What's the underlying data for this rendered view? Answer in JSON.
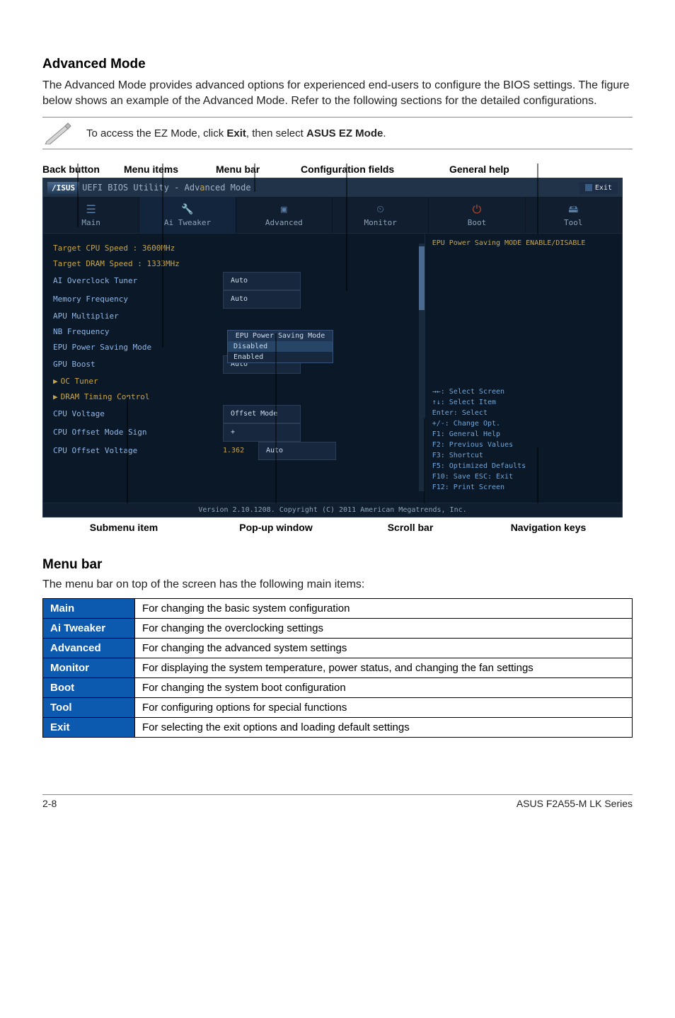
{
  "headings": {
    "advanced_mode": "Advanced Mode",
    "menu_bar": "Menu bar"
  },
  "intro": "The Advanced Mode provides advanced options for experienced end-users to configure the BIOS settings. The figure below shows an example of the Advanced Mode. Refer to the following sections for the detailed configurations.",
  "note": {
    "pre": "To access the EZ Mode, click ",
    "exit": "Exit",
    "mid": ", then select ",
    "ez": "ASUS EZ Mode",
    "post": "."
  },
  "top_labels": {
    "back": "Back button",
    "items": "Menu items",
    "menubar": "Menu bar",
    "config": "Configuration fields",
    "help": "General help"
  },
  "bottom_labels": {
    "submenu": "Submenu item",
    "popup": "Pop-up window",
    "scroll": "Scroll bar",
    "nav": "Navigation keys"
  },
  "bios": {
    "title": "UEFI BIOS Utility - Advanced Mode",
    "exit": "Exit",
    "tabs": {
      "main": "Main",
      "tweaker": "Ai Tweaker",
      "advanced": "Advanced",
      "monitor": "Monitor",
      "boot": "Boot",
      "tool": "Tool"
    },
    "settings": {
      "target_cpu": "Target CPU Speed : 3600MHz",
      "target_dram": "Target DRAM Speed : 1333MHz",
      "overclock": "AI Overclock Tuner",
      "overclock_val": "Auto",
      "mem_freq": "Memory Frequency",
      "mem_freq_val": "Auto",
      "apu_mult": "APU Multiplier",
      "nb_freq": "NB Frequency",
      "epu_mode": "EPU Power Saving Mode",
      "gpu_boost": "GPU Boost",
      "gpu_boost_val": "Auto",
      "oc_tuner": "OC Tuner",
      "dram_timing": "DRAM Timing Control",
      "cpu_voltage": "CPU Voltage",
      "cpu_voltage_val": "Offset Mode",
      "offset_sign": "CPU Offset Mode Sign",
      "offset_sign_val": "+",
      "offset_voltage": "CPU Offset Voltage",
      "offset_voltage_num": "1.362",
      "offset_voltage_val": "Auto"
    },
    "popup": {
      "title": "EPU Power Saving Mode",
      "opt1": "Disabled",
      "opt2": "Enabled"
    },
    "right_top": "EPU Power Saving MODE ENABLE/DISABLE",
    "nav_keys": "→←: Select Screen\n↑↓: Select Item\nEnter: Select\n+/-: Change Opt.\nF1: General Help\nF2: Previous Values\nF3: Shortcut\nF5: Optimized Defaults\nF10: Save  ESC: Exit\nF12: Print Screen",
    "footer": "Version 2.10.1208. Copyright (C) 2011 American Megatrends, Inc."
  },
  "menubar_intro": "The menu bar on top of the screen has the following main items:",
  "menubar_table": [
    {
      "name": "Main",
      "desc": "For changing the basic system configuration"
    },
    {
      "name": "Ai Tweaker",
      "desc": "For changing the overclocking settings"
    },
    {
      "name": "Advanced",
      "desc": "For changing the advanced system settings"
    },
    {
      "name": "Monitor",
      "desc": "For displaying the system temperature, power status, and changing the fan settings"
    },
    {
      "name": "Boot",
      "desc": "For changing the system boot configuration"
    },
    {
      "name": "Tool",
      "desc": "For configuring options for special functions"
    },
    {
      "name": "Exit",
      "desc": "For selecting the exit options and loading default settings"
    }
  ],
  "footer": {
    "left": "2-8",
    "right": "ASUS F2A55-M LK Series"
  }
}
